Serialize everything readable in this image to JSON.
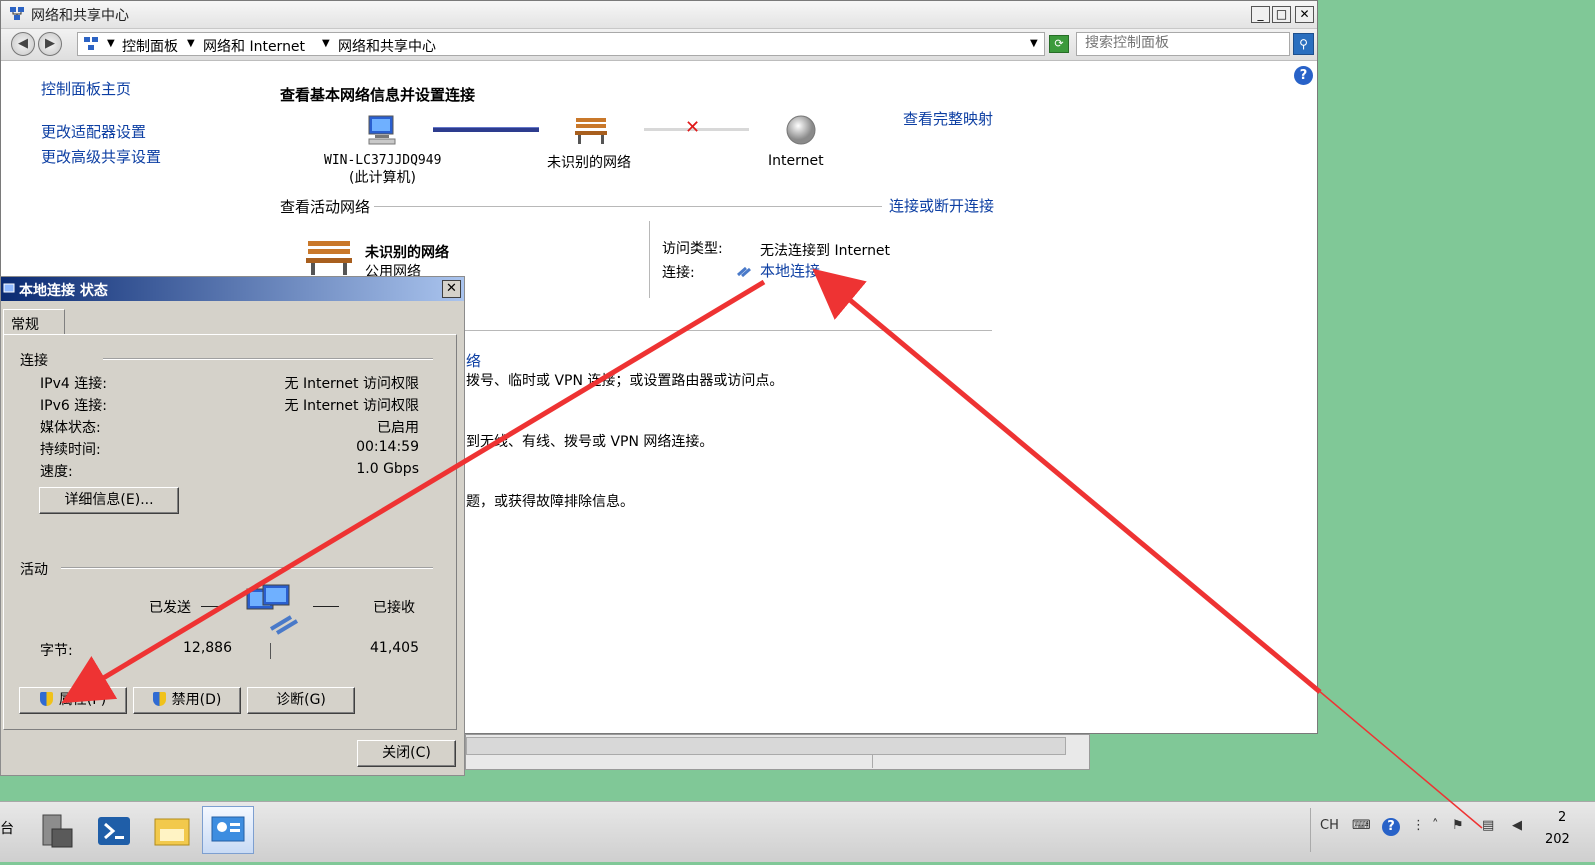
{
  "main_window": {
    "title": "网络和共享中心",
    "min_glyph": "_",
    "max_glyph": "□",
    "close_glyph": "✕",
    "breadcrumb": [
      "控制面板",
      "网络和 Internet",
      "网络和共享中心"
    ],
    "search_placeholder": "搜索控制面板",
    "help_glyph": "?",
    "sidebar": {
      "home": "控制面板主页",
      "adapter": "更改适配器设置",
      "advanced": "更改高级共享设置"
    },
    "heading": "查看基本网络信息并设置连接",
    "full_map": "查看完整映射",
    "map": {
      "computer_name": "WIN-LC37JJDQ949",
      "computer_sub": "(此计算机)",
      "network_name": "未识别的网络",
      "internet": "Internet"
    },
    "active_heading": "查看活动网络",
    "connect_link": "连接或断开连接",
    "active": {
      "name": "未识别的网络",
      "type": "公用网络",
      "access_label": "访问类型:",
      "access_value": "无法连接到 Internet",
      "conn_label": "连接:",
      "conn_value": "本地连接"
    },
    "partial_texts": [
      "络",
      "拨号、临时或 VPN 连接；或设置路由器或访问点。",
      "到无线、有线、拨号或 VPN 网络连接。",
      "题，或获得故障排除信息。"
    ]
  },
  "status_dialog": {
    "title": "本地连接 状态",
    "close_glyph": "✕",
    "tab": "常规",
    "group_connection": "连接",
    "rows": [
      {
        "label": "IPv4 连接:",
        "value": "无 Internet 访问权限"
      },
      {
        "label": "IPv6 连接:",
        "value": "无 Internet 访问权限"
      },
      {
        "label": "媒体状态:",
        "value": "已启用"
      },
      {
        "label": "持续时间:",
        "value": "00:14:59"
      },
      {
        "label": "速度:",
        "value": "1.0 Gbps"
      }
    ],
    "details_button": "详细信息(E)...",
    "group_activity": "活动",
    "sent_label": "已发送",
    "received_label": "已接收",
    "bytes_label": "字节:",
    "bytes_sent": "12,886",
    "bytes_received": "41,405",
    "properties_button": "属性(P)",
    "disable_button": "禁用(D)",
    "diagnose_button": "诊断(G)",
    "close_button": "关闭(C)"
  },
  "taskbar": {
    "start_fragment": "台",
    "lang": "CH",
    "clock_top": "2",
    "clock_bottom": "202"
  },
  "colors": {
    "desktop": "#80c897",
    "link": "#0d3fa3",
    "arrow": "#ee3333",
    "title_blue": "#0a2a72"
  }
}
